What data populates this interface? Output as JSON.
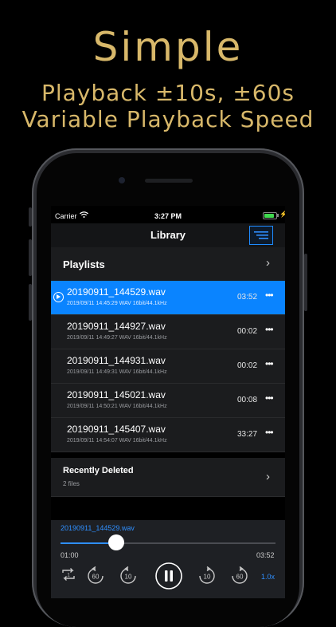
{
  "promo": {
    "title": "Simple",
    "line1": "Playback ±10s, ±60s",
    "line2": "Variable Playback Speed"
  },
  "status_bar": {
    "carrier": "Carrier",
    "time": "3:27 PM"
  },
  "nav": {
    "title": "Library"
  },
  "playlists": {
    "label": "Playlists"
  },
  "recordings": [
    {
      "name": "20190911_144529.wav",
      "meta": "2019/09/11 14:45:29   WAV   16bit/44.1kHz",
      "duration": "03:52",
      "selected": true
    },
    {
      "name": "20190911_144927.wav",
      "meta": "2019/09/11 14:49:27   WAV   16bit/44.1kHz",
      "duration": "00:02",
      "selected": false
    },
    {
      "name": "20190911_144931.wav",
      "meta": "2019/09/11 14:49:31   WAV   16bit/44.1kHz",
      "duration": "00:02",
      "selected": false
    },
    {
      "name": "20190911_145021.wav",
      "meta": "2019/09/11 14:50:21   WAV   16bit/44.1kHz",
      "duration": "00:08",
      "selected": false
    },
    {
      "name": "20190911_145407.wav",
      "meta": "2019/09/11 14:54:07   WAV   16bit/44.1kHz",
      "duration": "33:27",
      "selected": false
    }
  ],
  "recently_deleted": {
    "label": "Recently Deleted",
    "count": "2 files"
  },
  "player": {
    "title": "20190911_144529.wav",
    "elapsed": "01:00",
    "total": "03:52",
    "progress": 0.26,
    "back60": "60",
    "back10": "10",
    "fwd10": "10",
    "fwd60": "60",
    "speed": "1.0x"
  },
  "colors": {
    "gold": "#d8b86a",
    "accent": "#0a84ff",
    "battery": "#3fd84e"
  }
}
